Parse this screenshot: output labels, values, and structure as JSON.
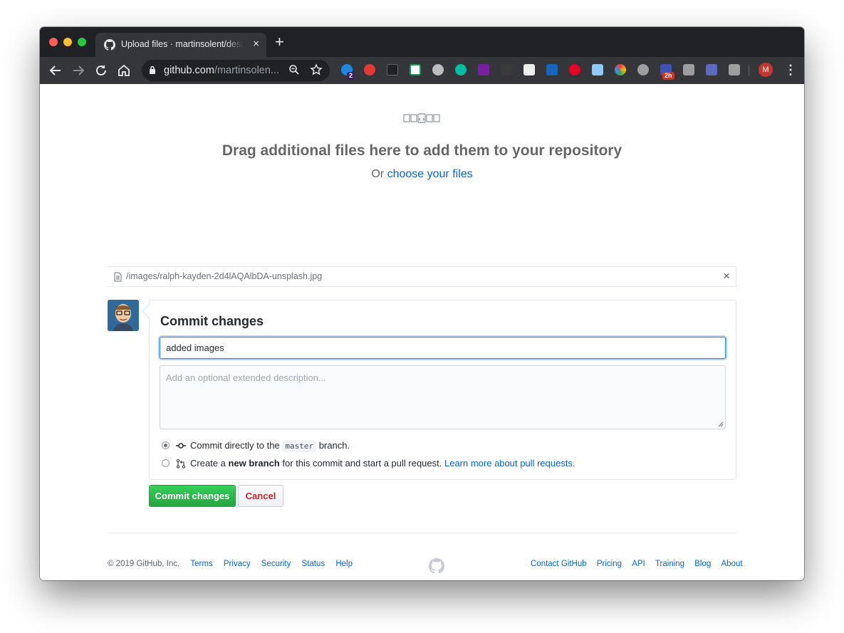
{
  "browser": {
    "tab_title": "Upload files · martinsolent/design",
    "tab_close": "×",
    "new_tab": "+",
    "url_host": "github.com",
    "url_path": "/martinsolen...",
    "ext_badge_count": "2",
    "ext_badge_time": "2h",
    "profile_initial": "M",
    "menu": "⋮"
  },
  "upload": {
    "title": "Drag additional files here to add them to your repository",
    "or_text": "Or",
    "choose_link": "choose your files"
  },
  "file": {
    "path": "/images/ralph-kayden-2d4lAQAlbDA-unsplash.jpg",
    "remove": "×"
  },
  "commit": {
    "title": "Commit changes",
    "summary_value": "added images",
    "description_placeholder": "Add an optional extended description...",
    "option_direct_pre": "Commit directly to the",
    "option_direct_branch": "master",
    "option_direct_post": "branch.",
    "option_new_pre": "Create a",
    "option_new_bold": "new branch",
    "option_new_post": "for this commit and start a pull request.",
    "option_new_link": "Learn more about pull requests.",
    "submit_label": "Commit changes",
    "cancel_label": "Cancel"
  },
  "footer": {
    "copyright": "© 2019 GitHub, Inc.",
    "left_links": [
      "Terms",
      "Privacy",
      "Security",
      "Status",
      "Help"
    ],
    "right_links": [
      "Contact GitHub",
      "Pricing",
      "API",
      "Training",
      "Blog",
      "About"
    ]
  },
  "colors": {
    "link": "#0366d6",
    "primary_button": "#28a745",
    "danger_text": "#cb2431",
    "chrome_dark": "#202124"
  }
}
